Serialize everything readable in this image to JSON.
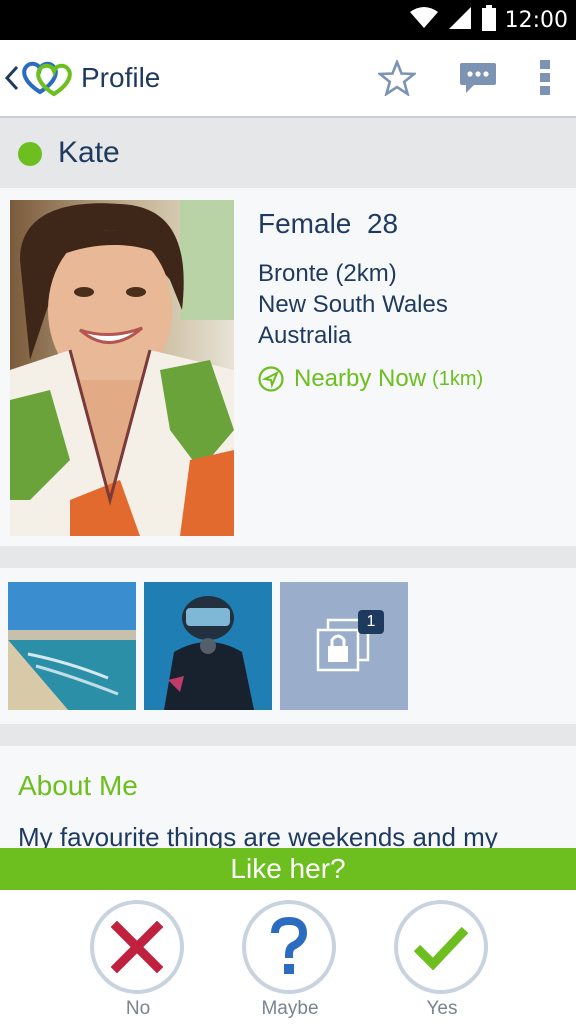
{
  "status_bar": {
    "time": "12:00"
  },
  "app_bar": {
    "title": "Profile",
    "icons": [
      "back-chevron-icon",
      "hearts-logo-icon",
      "star-icon",
      "chat-icon",
      "overflow-menu-icon"
    ]
  },
  "profile": {
    "name": "Kate",
    "online": true,
    "gender": "Female",
    "age": "28",
    "suburb": "Bronte (2km)",
    "state": "New South Wales",
    "country": "Australia",
    "nearby_label": "Nearby Now",
    "nearby_distance": "(1km)"
  },
  "gallery": {
    "photos": [
      "beach-photo",
      "diver-photo"
    ],
    "locked_count": "1"
  },
  "about": {
    "heading": "About Me",
    "text": "My favourite things are weekends and my"
  },
  "like_prompt": "Like her?",
  "actions": {
    "no": "No",
    "maybe": "Maybe",
    "yes": "Yes"
  },
  "colors": {
    "accent_green": "#6cbf1e",
    "navy": "#1f3a5f",
    "no_red": "#c0213e",
    "maybe_blue": "#2c6cc0",
    "locked_tile": "#9aaecb"
  }
}
